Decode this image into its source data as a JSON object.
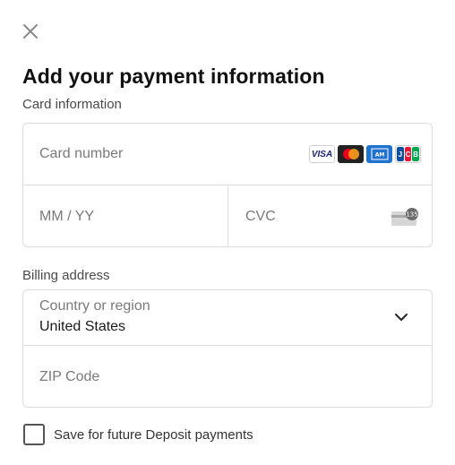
{
  "dialog": {
    "title": "Add your payment information"
  },
  "card": {
    "section_label": "Card information",
    "number_placeholder": "Card number",
    "expiry_placeholder": "MM / YY",
    "cvc_placeholder": "CVC",
    "brands": [
      "VISA",
      "Mastercard",
      "AMEX",
      "JCB"
    ],
    "cvc_icon_text": "135"
  },
  "billing": {
    "section_label": "Billing address",
    "country_label": "Country or region",
    "country_value": "United States",
    "zip_placeholder": "ZIP Code"
  },
  "save": {
    "label": "Save for future Deposit payments",
    "checked": false
  },
  "colors": {
    "border": "#dcdcdc",
    "title": "#111111",
    "placeholder": "#7a7a7a"
  }
}
